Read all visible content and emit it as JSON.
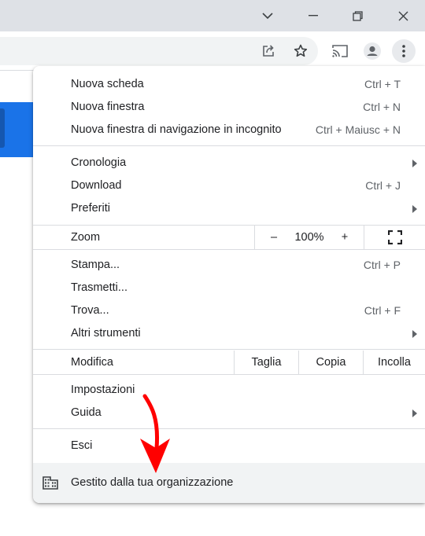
{
  "colors": {
    "accent": "#1a73e8",
    "arrow": "#ff0000",
    "footer_bg": "#f1f3f4"
  },
  "window_controls": [
    "chevron-down-icon",
    "minimize-icon",
    "restore-icon",
    "close-icon"
  ],
  "toolbar": [
    "share-icon",
    "bookmark-star-icon",
    "cast-icon",
    "profile-icon",
    "kebab-menu-icon"
  ],
  "menu": {
    "new_tab": {
      "label": "Nuova scheda",
      "shortcut": "Ctrl + T"
    },
    "new_window": {
      "label": "Nuova finestra",
      "shortcut": "Ctrl + N"
    },
    "incognito": {
      "label": "Nuova finestra di navigazione in incognito",
      "shortcut": "Ctrl + Maiusc + N"
    },
    "history": {
      "label": "Cronologia"
    },
    "downloads": {
      "label": "Download",
      "shortcut": "Ctrl + J"
    },
    "bookmarks": {
      "label": "Preferiti"
    },
    "zoom": {
      "label": "Zoom",
      "minus": "–",
      "value": "100%",
      "plus": "+"
    },
    "print": {
      "label": "Stampa...",
      "shortcut": "Ctrl + P"
    },
    "cast": {
      "label": "Trasmetti..."
    },
    "find": {
      "label": "Trova...",
      "shortcut": "Ctrl + F"
    },
    "more_tools": {
      "label": "Altri strumenti"
    },
    "edit": {
      "label": "Modifica",
      "cut": "Taglia",
      "copy": "Copia",
      "paste": "Incolla"
    },
    "settings": {
      "label": "Impostazioni"
    },
    "help": {
      "label": "Guida"
    },
    "exit": {
      "label": "Esci"
    },
    "managed": {
      "label": "Gestito dalla tua organizzazione"
    }
  }
}
